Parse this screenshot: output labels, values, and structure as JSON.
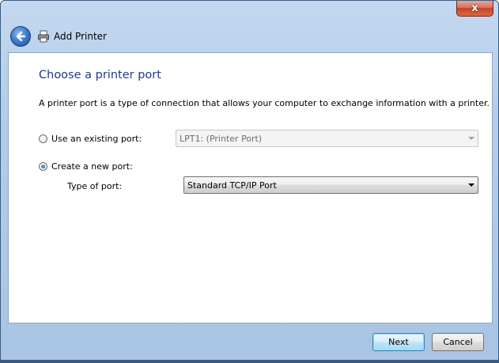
{
  "window": {
    "title": "Add Printer",
    "close_label": "x"
  },
  "page": {
    "heading": "Choose a printer port",
    "description": "A printer port is a type of connection that allows your computer to exchange information with a printer."
  },
  "options": {
    "existing_port_label": "Use an existing port:",
    "existing_port_selected": false,
    "existing_port_value": "LPT1: (Printer Port)",
    "new_port_label": "Create a new port:",
    "new_port_selected": true,
    "type_of_port_label": "Type of port:",
    "type_of_port_value": "Standard TCP/IP Port"
  },
  "footer": {
    "next_label": "Next",
    "cancel_label": "Cancel"
  },
  "colors": {
    "heading": "#1e3a8c",
    "frame": "#b5cde9",
    "content_bg": "#ffffff"
  },
  "icons": {
    "back": "back-arrow-icon",
    "printer": "printer-icon",
    "close": "close-icon"
  }
}
